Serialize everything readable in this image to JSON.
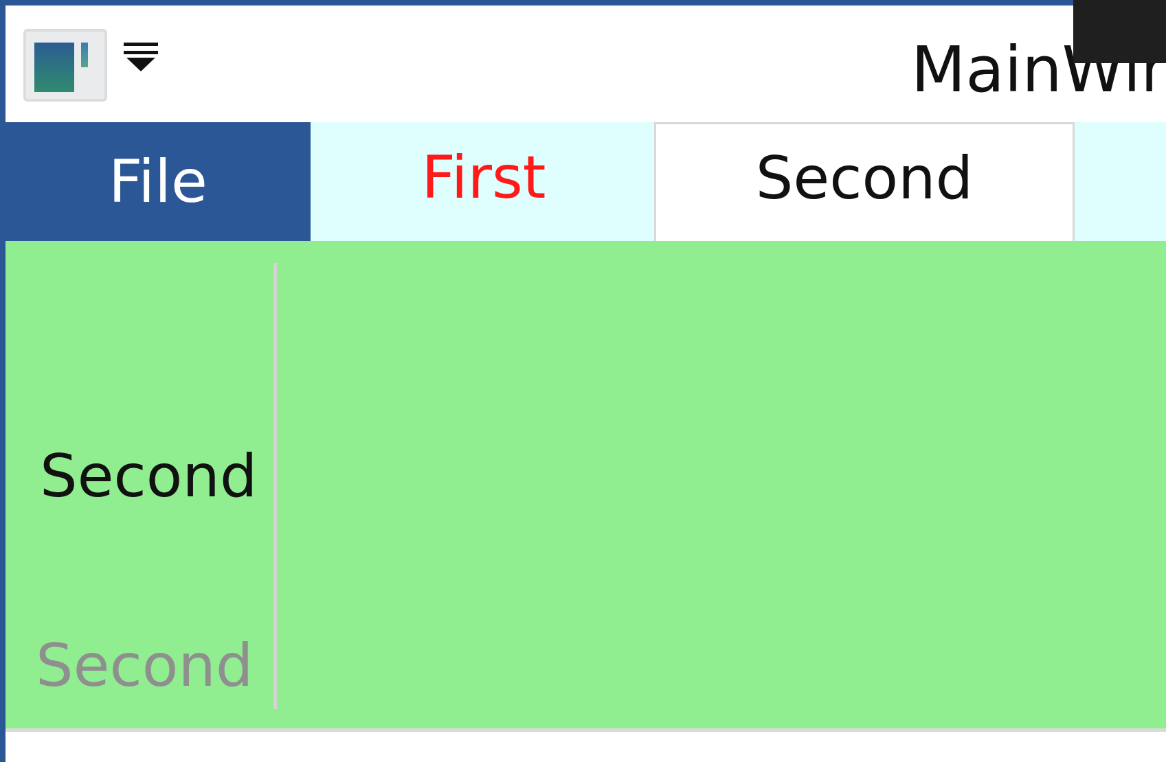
{
  "window": {
    "title": "MainWindow"
  },
  "titlebar": {
    "app_icon": "window-app-icon",
    "quick_access_icon": "customize-quick-access-icon"
  },
  "ribbon": {
    "tabs": [
      {
        "label": "File"
      },
      {
        "label": "First"
      },
      {
        "label": "Second"
      }
    ],
    "selected_tab": "Second",
    "group": {
      "content_label": "Second",
      "footer_label": "Second"
    }
  },
  "colors": {
    "accent": "#2b5797",
    "tab_strip_bg": "#dffefe",
    "first_tab_text": "#ff1a1a",
    "ribbon_content_bg": "#90ee90",
    "disabled_text": "#8f8f8f"
  }
}
